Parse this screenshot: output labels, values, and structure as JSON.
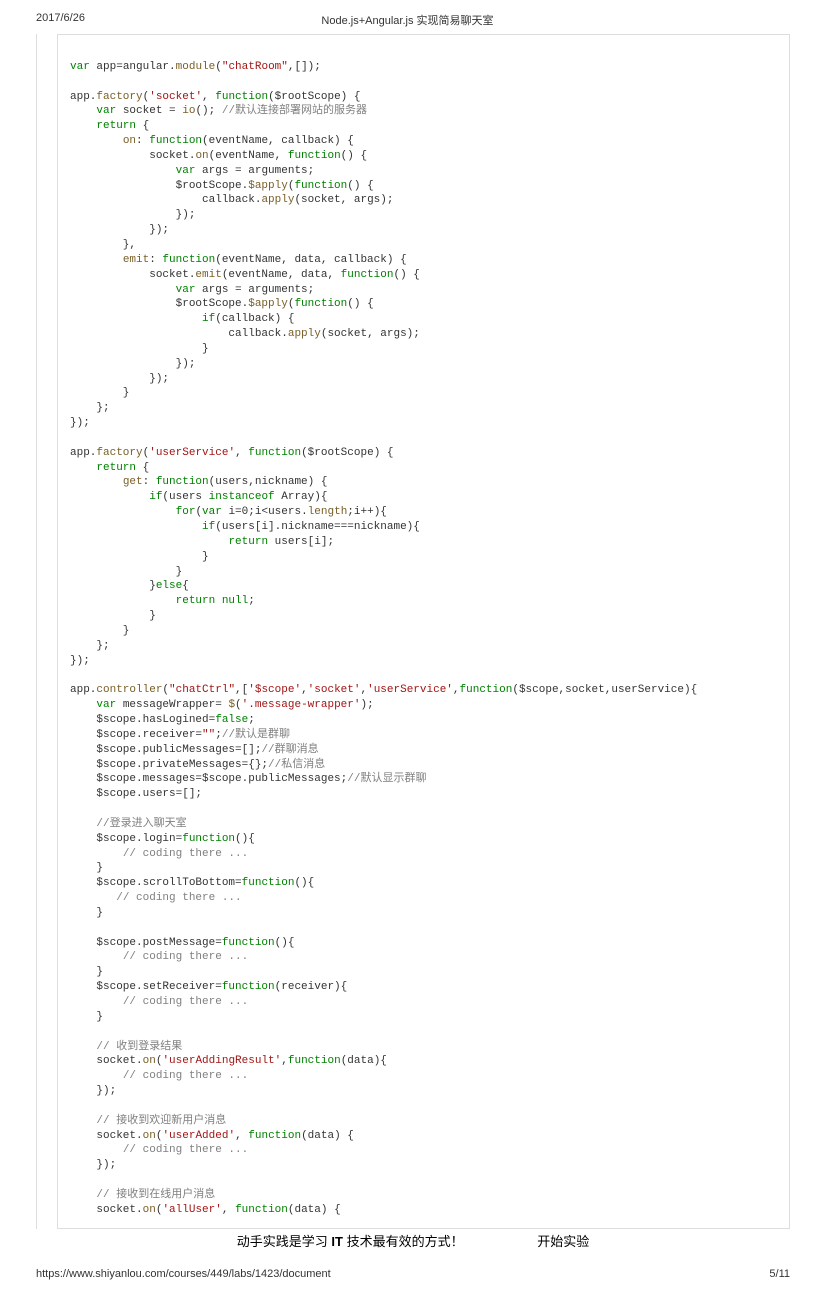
{
  "header": {
    "date": "2017/6/26",
    "title": "Node.js+Angular.js 实现简易聊天室"
  },
  "code": {
    "l1_var": "var",
    "l1_rest": " app=angular.",
    "l1_mod": "module",
    "l1_p": "(",
    "l1_str": "\"chatRoom\"",
    "l1_end": ",[]);",
    "l3_app": "app.",
    "l3_fac": "factory",
    "l3_p": "(",
    "l3_str": "'socket'",
    "l3_mid": ", ",
    "l3_fn": "function",
    "l3_args": "($rootScope) {",
    "l4_ind": "    ",
    "l4_var": "var",
    "l4_sock": " socket = ",
    "l4_io": "io",
    "l4_rest": "(); ",
    "l4_cmt": "//默认连接部署网站的服务器",
    "l5_ind": "    ",
    "l5_ret": "return",
    "l5_b": " {",
    "l6_ind": "        ",
    "l6_on": "on",
    "l6_c": ": ",
    "l6_fn": "function",
    "l6_args": "(eventName, callback) {",
    "l7_ind": "            ",
    "l7_s": "socket.",
    "l7_on": "on",
    "l7_p": "(eventName, ",
    "l7_fn": "function",
    "l7_end": "() {",
    "l8_ind": "                ",
    "l8_var": "var",
    "l8_r": " args = arguments;",
    "l9_ind": "                $rootScope.",
    "l9_ap": "$apply",
    "l9_p": "(",
    "l9_fn": "function",
    "l9_end": "() {",
    "l10_ind": "                    callback.",
    "l10_ap": "apply",
    "l10_end": "(socket, args);",
    "l11": "                });",
    "l12": "            });",
    "l13": "        },",
    "l14_ind": "        ",
    "l14_em": "emit",
    "l14_c": ": ",
    "l14_fn": "function",
    "l14_end": "(eventName, data, callback) {",
    "l15_ind": "            socket.",
    "l15_em": "emit",
    "l15_p": "(eventName, data, ",
    "l15_fn": "function",
    "l15_end": "() {",
    "l16_ind": "                ",
    "l16_var": "var",
    "l16_r": " args = arguments;",
    "l17_ind": "                $rootScope.",
    "l17_ap": "$apply",
    "l17_p": "(",
    "l17_fn": "function",
    "l17_end": "() {",
    "l18_ind": "                    ",
    "l18_if": "if",
    "l18_r": "(callback) {",
    "l19_ind": "                        callback.",
    "l19_ap": "apply",
    "l19_end": "(socket, args);",
    "l20": "                    }",
    "l21": "                });",
    "l22": "            });",
    "l23": "        }",
    "l24": "    };",
    "l25": "});",
    "l27_app": "app.",
    "l27_fac": "factory",
    "l27_p": "(",
    "l27_str": "'userService'",
    "l27_mid": ", ",
    "l27_fn": "function",
    "l27_end": "($rootScope) {",
    "l28_ind": "    ",
    "l28_ret": "return",
    "l28_b": " {",
    "l29_ind": "        ",
    "l29_get": "get",
    "l29_c": ": ",
    "l29_fn": "function",
    "l29_end": "(users,nickname) {",
    "l30_ind": "            ",
    "l30_if": "if",
    "l30_p": "(users ",
    "l30_io": "instanceof",
    "l30_end": " Array){",
    "l31_ind": "                ",
    "l31_for": "for",
    "l31_p": "(",
    "l31_var": "var",
    "l31_rest": " i=0;i<users.",
    "l31_len": "length",
    "l31_end": ";i++){",
    "l32_ind": "                    ",
    "l32_if": "if",
    "l32_end": "(users[i].nickname===nickname){",
    "l33_ind": "                        ",
    "l33_ret": "return",
    "l33_end": " users[i];",
    "l34": "                    }",
    "l35": "                }",
    "l36_ind": "            }",
    "l36_else": "else",
    "l36_end": "{",
    "l37_ind": "                ",
    "l37_ret": "return",
    "l37_null": " null",
    "l37_end": ";",
    "l38": "            }",
    "l39": "        }",
    "l40": "    };",
    "l41": "});",
    "l43_app": "app.",
    "l43_ctrl": "controller",
    "l43_p": "(",
    "l43_s1": "\"chatCtrl\"",
    "l43_c": ",[",
    "l43_s2": "'$scope'",
    "l43_c2": ",",
    "l43_s3": "'socket'",
    "l43_c3": ",",
    "l43_s4": "'userService'",
    "l43_c4": ",",
    "l43_fn": "function",
    "l43_end": "($scope,socket,userService){",
    "l44_ind": "    ",
    "l44_var": "var",
    "l44_mw": " messageWrapper= ",
    "l44_dol": "$",
    "l44_p": "(",
    "l44_str": "'.message-wrapper'",
    "l44_end": ");",
    "l45_ind": "    $scope.hasLogined=",
    "l45_false": "false",
    "l45_end": ";",
    "l46_ind": "    $scope.receiver=",
    "l46_str": "\"\"",
    "l46_s": ";",
    "l46_cmt": "//默认是群聊",
    "l47_ind": "    $scope.publicMessages=[];",
    "l47_cmt": "//群聊消息",
    "l48_ind": "    $scope.privateMessages={};",
    "l48_cmt": "//私信消息",
    "l49_ind": "    $scope.messages=$scope.publicMessages;",
    "l49_cmt": "//默认显示群聊",
    "l50": "    $scope.users=[];",
    "l52_ind": "    ",
    "l52_cmt": "//登录进入聊天室",
    "l53_ind": "    $scope.login=",
    "l53_fn": "function",
    "l53_end": "(){",
    "l54_ind": "        ",
    "l54_cmt": "// coding there ...",
    "l55": "    }",
    "l56_ind": "    $scope.scrollToBottom=",
    "l56_fn": "function",
    "l56_end": "(){",
    "l57_ind": "       ",
    "l57_cmt": "// coding there ...",
    "l58": "    }",
    "l60_ind": "    $scope.postMessage=",
    "l60_fn": "function",
    "l60_end": "(){",
    "l61_ind": "        ",
    "l61_cmt": "// coding there ...",
    "l62": "    }",
    "l63_ind": "    $scope.setReceiver=",
    "l63_fn": "function",
    "l63_end": "(receiver){",
    "l64_ind": "        ",
    "l64_cmt": "// coding there ...",
    "l65": "    }",
    "l67_ind": "    ",
    "l67_cmt": "// 收到登录结果",
    "l68_ind": "    socket.",
    "l68_on": "on",
    "l68_p": "(",
    "l68_str": "'userAddingResult'",
    "l68_c": ",",
    "l68_fn": "function",
    "l68_end": "(data){",
    "l69_ind": "        ",
    "l69_cmt": "// coding there ...",
    "l70": "    });",
    "l72_ind": "    ",
    "l72_cmt": "// 接收到欢迎新用户消息",
    "l73_ind": "    socket.",
    "l73_on": "on",
    "l73_p": "(",
    "l73_str": "'userAdded'",
    "l73_c": ", ",
    "l73_fn": "function",
    "l73_end": "(data) {",
    "l74_ind": "        ",
    "l74_cmt": "// coding there ...",
    "l75": "    });",
    "l77_ind": "    ",
    "l77_cmt": "// 接收到在线用户消息",
    "l78_ind": "    socket.",
    "l78_on": "on",
    "l78_p": "(",
    "l78_str": "'allUser'",
    "l78_c": ", ",
    "l78_fn": "function",
    "l78_end": "(data) {"
  },
  "banner": {
    "slogan_pre": "动手实践是学习 ",
    "slogan_it": "IT",
    "slogan_post": " 技术最有效的方式！",
    "start": "开始实验"
  },
  "footer": {
    "url": "https://www.shiyanlou.com/courses/449/labs/1423/document",
    "page": "5/11"
  }
}
